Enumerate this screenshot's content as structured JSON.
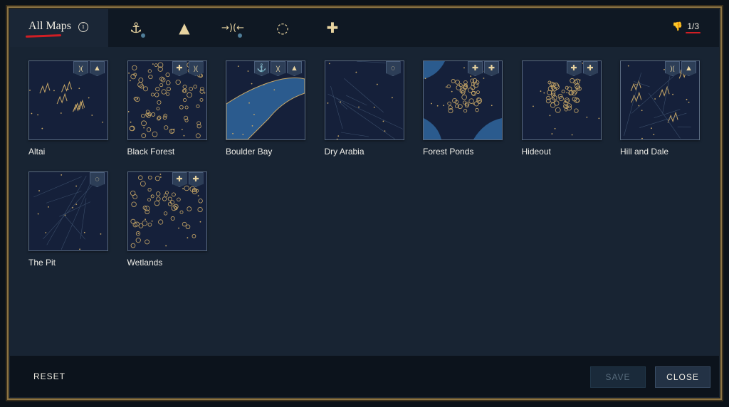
{
  "header": {
    "tab_label": "All Maps",
    "info_icon": "info-icon",
    "filters": [
      {
        "icon": "anchor-icon",
        "glyph": "⚓",
        "has_dot": true
      },
      {
        "icon": "mountain-icon",
        "glyph": "▲",
        "has_dot": false
      },
      {
        "icon": "chokepoint-icon",
        "glyph": "→)(←",
        "has_dot": true
      },
      {
        "icon": "ring-icon",
        "glyph": "◌",
        "has_dot": false
      },
      {
        "icon": "plus-icon",
        "glyph": "✚",
        "has_dot": false
      }
    ],
    "counter": {
      "icon": "thumbs-down-icon",
      "value": "1/3"
    }
  },
  "maps": [
    {
      "name": "Altai",
      "badges": [
        ")(",
        "▲"
      ],
      "variant": "mountain"
    },
    {
      "name": "Black Forest",
      "badges": [
        "✚",
        ")("
      ],
      "variant": "forest"
    },
    {
      "name": "Boulder Bay",
      "badges": [
        "⚓",
        ")(",
        "▲"
      ],
      "variant": "bay"
    },
    {
      "name": "Dry Arabia",
      "badges": [
        "◌"
      ],
      "variant": "dry"
    },
    {
      "name": "Forest Ponds",
      "badges": [
        "✚",
        "✚"
      ],
      "variant": "ponds"
    },
    {
      "name": "Hideout",
      "badges": [
        "✚",
        "✚"
      ],
      "variant": "hideout"
    },
    {
      "name": "Hill and Dale",
      "badges": [
        ")(",
        "▲"
      ],
      "variant": "hills"
    },
    {
      "name": "The Pit",
      "badges": [
        "◌"
      ],
      "variant": "pit"
    },
    {
      "name": "Wetlands",
      "badges": [
        "✚",
        "✚"
      ],
      "variant": "wetlands"
    }
  ],
  "footer": {
    "reset_label": "RESET",
    "save_label": "SAVE",
    "close_label": "CLOSE"
  },
  "colors": {
    "accent_gold": "#e7d3a0",
    "frame_gold": "#8c7444",
    "underline_red": "#d11e24",
    "panel_bg": "#182433",
    "water_blue": "#2b5b8e"
  }
}
